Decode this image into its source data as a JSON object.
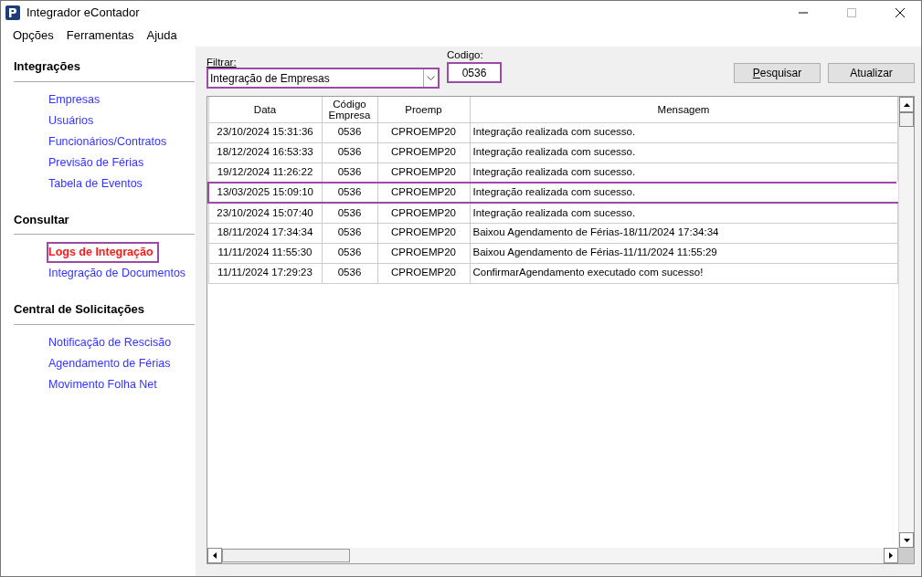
{
  "window": {
    "title": "Integrador eContador"
  },
  "menu": [
    "Opções",
    "Ferramentas",
    "Ajuda"
  ],
  "sidebar": [
    {
      "title": "Integrações",
      "items": [
        {
          "label": "Empresas",
          "selected": false,
          "annotated": false
        },
        {
          "label": "Usuários",
          "selected": false,
          "annotated": false
        },
        {
          "label": "Funcionários/Contratos",
          "selected": false,
          "annotated": false
        },
        {
          "label": "Previsão de Férias",
          "selected": false,
          "annotated": false
        },
        {
          "label": "Tabela de Eventos",
          "selected": false,
          "annotated": false
        }
      ]
    },
    {
      "title": "Consultar",
      "items": [
        {
          "label": "Logs de Integração",
          "selected": true,
          "annotated": true
        },
        {
          "label": "Integração de Documentos",
          "selected": false,
          "annotated": false
        }
      ]
    },
    {
      "title": "Central de Solicitações",
      "items": [
        {
          "label": "Notificação de Rescisão",
          "selected": false,
          "annotated": false
        },
        {
          "label": "Agendamento de Férias",
          "selected": false,
          "annotated": false
        },
        {
          "label": "Movimento Folha Net",
          "selected": false,
          "annotated": false
        }
      ]
    }
  ],
  "filter": {
    "label": "Filtrar:",
    "value": "Integração de Empresas",
    "annotated": true
  },
  "code": {
    "label": "Codigo:",
    "value": "0536",
    "annotated": true
  },
  "buttons": [
    {
      "label": "Pesquisar",
      "access_key_underlined": true
    },
    {
      "label": "Atualizar",
      "access_key_underlined": false
    }
  ],
  "table": {
    "columns": [
      "Data",
      "Código Empresa",
      "Proemp",
      "Mensagem"
    ],
    "rows": [
      {
        "cells": [
          "23/10/2024 15:31:36",
          "0536",
          "CPROEMP20",
          "Integração realizada com sucesso."
        ],
        "annotated": false
      },
      {
        "cells": [
          "18/12/2024 16:53:33",
          "0536",
          "CPROEMP20",
          "Integração realizada com sucesso."
        ],
        "annotated": false
      },
      {
        "cells": [
          "19/12/2024 11:26:22",
          "0536",
          "CPROEMP20",
          "Integração realizada com sucesso."
        ],
        "annotated": false
      },
      {
        "cells": [
          "13/03/2025 15:09:10",
          "0536",
          "CPROEMP20",
          "Integração realizada com sucesso."
        ],
        "annotated": true
      },
      {
        "cells": [
          "23/10/2024 15:07:40",
          "0536",
          "CPROEMP20",
          "Integração realizada com sucesso."
        ],
        "annotated": false
      },
      {
        "cells": [
          "18/11/2024 17:34:34",
          "0536",
          "CPROEMP20",
          "Baixou Agendamento de Férias-18/11/2024 17:34:34"
        ],
        "annotated": false
      },
      {
        "cells": [
          "11/11/2024 11:55:30",
          "0536",
          "CPROEMP20",
          "Baixou Agendamento de Férias-11/11/2024 11:55:29"
        ],
        "annotated": false
      },
      {
        "cells": [
          "11/11/2024 17:29:23",
          "0536",
          "CPROEMP20",
          "ConfirmarAgendamento executado com sucesso!"
        ],
        "annotated": false
      }
    ]
  }
}
